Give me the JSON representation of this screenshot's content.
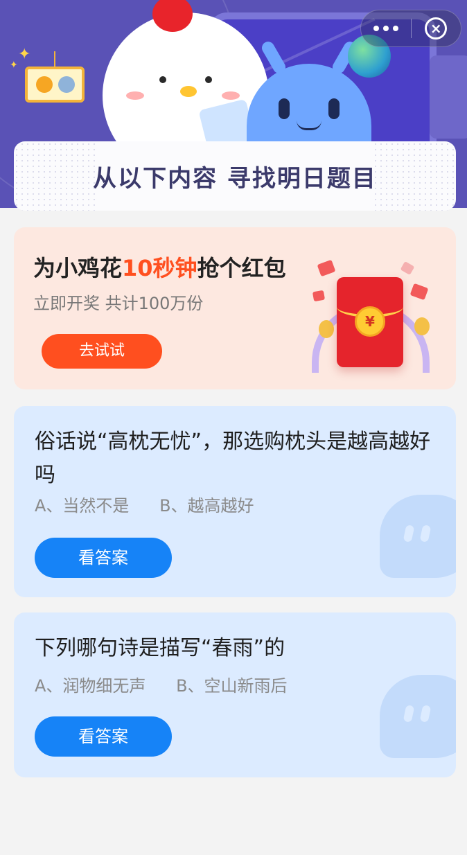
{
  "header": {
    "title": "从以下内容 寻找明日题目",
    "capsule": {
      "more_icon": "more-dots-icon",
      "close_icon": "close-circle-icon"
    }
  },
  "promo": {
    "headline_prefix": "为小鸡花",
    "headline_highlight": "10秒钟",
    "headline_suffix": "抢个红包",
    "subtitle": "立即开奖 共计100万份",
    "button_label": "去试试",
    "coin_symbol": "¥",
    "accent_color": "#ff4f1f"
  },
  "questions": [
    {
      "text": "俗话说“高枕无忧”，那选购枕头是越高越好吗",
      "option_a": "A、当然不是",
      "option_b": "B、越高越好",
      "button_label": "看答案"
    },
    {
      "text": "下列哪句诗是描写“春雨”的",
      "option_a": "A、润物细无声",
      "option_b": "B、空山新雨后",
      "button_label": "看答案"
    }
  ],
  "colors": {
    "header_bg": "#5a52b6",
    "question_card_bg": "#dcebff",
    "answer_button": "#1683f7",
    "promo_card_bg": "#fde8e0"
  }
}
